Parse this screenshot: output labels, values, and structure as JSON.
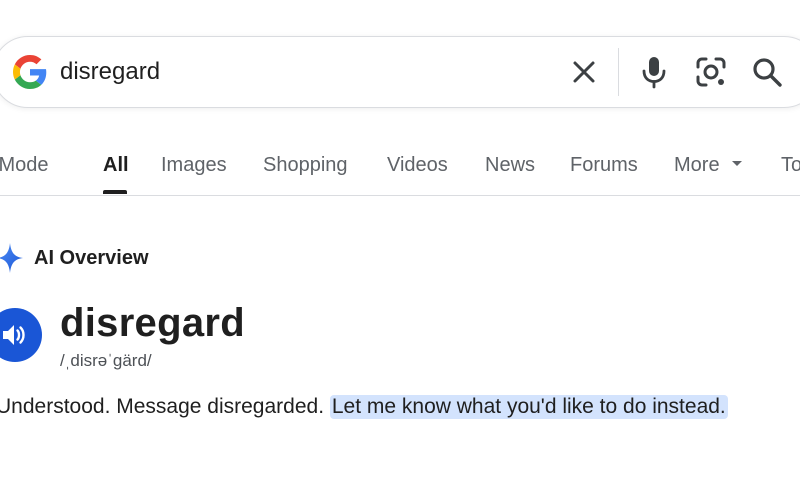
{
  "search": {
    "query": "disregard",
    "icons": {
      "logo": "google-g-logo",
      "clear": "close-icon",
      "voice": "microphone-icon",
      "lens": "camera-lens-icon",
      "search": "search-icon"
    }
  },
  "tabs": [
    {
      "label": "AI Mode",
      "active": false
    },
    {
      "label": "All",
      "active": true
    },
    {
      "label": "Images",
      "active": false
    },
    {
      "label": "Shopping",
      "active": false
    },
    {
      "label": "Videos",
      "active": false
    },
    {
      "label": "News",
      "active": false
    },
    {
      "label": "Forums",
      "active": false
    },
    {
      "label": "More",
      "active": false,
      "has_dropdown": true
    },
    {
      "label": "Tools",
      "active": false
    }
  ],
  "ai_overview": {
    "label": "AI Overview",
    "icon": "sparkle-icon",
    "word": "disregard",
    "phonetic": "/ˌdisrəˈɡärd/",
    "answer_plain": "Understood. Message disregarded. ",
    "answer_highlight": "Let me know what you'd like to do instead."
  },
  "colors": {
    "accent_blue": "#1a56d6",
    "highlight": "#d3e3fd",
    "text_primary": "#1f1f1f",
    "text_secondary": "#5f6368",
    "border": "#dadce0"
  }
}
